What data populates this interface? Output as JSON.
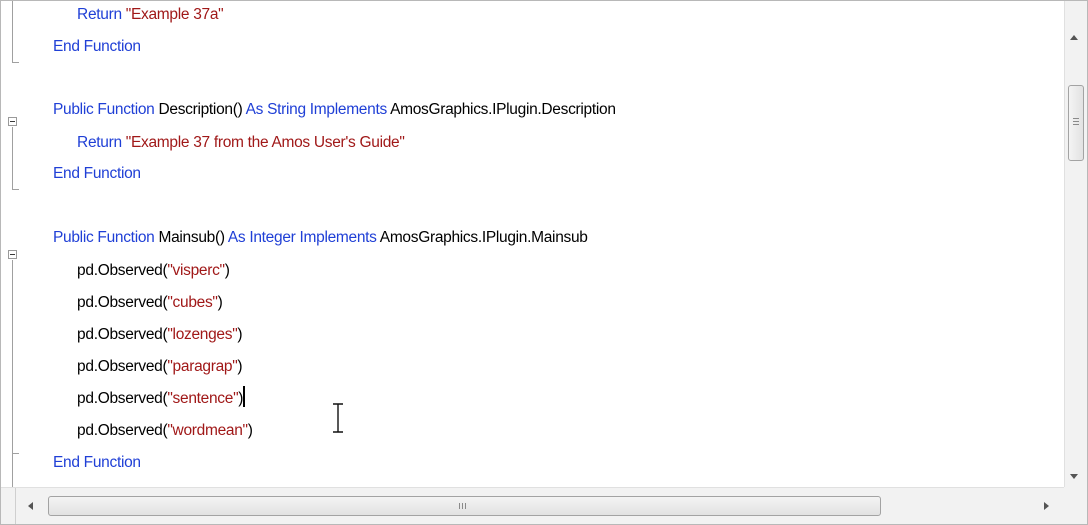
{
  "editor": {
    "lines": [
      {
        "indent": "   ",
        "tokens": [
          {
            "text": "Return ",
            "kind": "kw"
          },
          {
            "text": "\"Example 37a\"",
            "kind": "str"
          }
        ]
      },
      {
        "indent": "",
        "tokens": [
          {
            "text": "End Function",
            "kind": "kw"
          }
        ]
      },
      {
        "indent": "",
        "tokens": []
      },
      {
        "indent": "",
        "tokens": [
          {
            "text": "Public Function ",
            "kind": "kw"
          },
          {
            "text": "Description() ",
            "kind": "plain"
          },
          {
            "text": "As String Implements ",
            "kind": "kw"
          },
          {
            "text": "AmosGraphics.IPlugin.Description",
            "kind": "plain"
          }
        ]
      },
      {
        "indent": "   ",
        "tokens": [
          {
            "text": "Return ",
            "kind": "kw"
          },
          {
            "text": "\"Example 37 from the Amos User's Guide\"",
            "kind": "str"
          }
        ]
      },
      {
        "indent": "",
        "tokens": [
          {
            "text": "End Function",
            "kind": "kw"
          }
        ]
      },
      {
        "indent": "",
        "tokens": []
      },
      {
        "indent": "",
        "tokens": [
          {
            "text": "Public Function ",
            "kind": "kw"
          },
          {
            "text": "Mainsub() ",
            "kind": "plain"
          },
          {
            "text": "As Integer Implements ",
            "kind": "kw"
          },
          {
            "text": "AmosGraphics.IPlugin.Mainsub",
            "kind": "plain"
          }
        ]
      },
      {
        "indent": "   ",
        "tokens": [
          {
            "text": "pd.Observed(",
            "kind": "plain"
          },
          {
            "text": "\"visperc\"",
            "kind": "str"
          },
          {
            "text": ")",
            "kind": "plain"
          }
        ]
      },
      {
        "indent": "   ",
        "tokens": [
          {
            "text": "pd.Observed(",
            "kind": "plain"
          },
          {
            "text": "\"cubes\"",
            "kind": "str"
          },
          {
            "text": ")",
            "kind": "plain"
          }
        ]
      },
      {
        "indent": "   ",
        "tokens": [
          {
            "text": "pd.Observed(",
            "kind": "plain"
          },
          {
            "text": "\"lozenges\"",
            "kind": "str"
          },
          {
            "text": ")",
            "kind": "plain"
          }
        ]
      },
      {
        "indent": "   ",
        "tokens": [
          {
            "text": "pd.Observed(",
            "kind": "plain"
          },
          {
            "text": "\"paragrap\"",
            "kind": "str"
          },
          {
            "text": ")",
            "kind": "plain"
          }
        ]
      },
      {
        "indent": "   ",
        "tokens": [
          {
            "text": "pd.Observed(",
            "kind": "plain"
          },
          {
            "text": "\"sentence\"",
            "kind": "str"
          },
          {
            "text": ")",
            "kind": "plain"
          }
        ],
        "caret": true
      },
      {
        "indent": "   ",
        "tokens": [
          {
            "text": "pd.Observed(",
            "kind": "plain"
          },
          {
            "text": "\"wordmean\"",
            "kind": "str"
          },
          {
            "text": ")",
            "kind": "plain"
          }
        ]
      },
      {
        "indent": "",
        "tokens": [
          {
            "text": "End Function",
            "kind": "kw"
          }
        ]
      }
    ]
  },
  "scrollbars": {
    "vertical_grip_icon": "grip-lines-icon",
    "horizontal_grip_icon": "grip-lines-icon"
  },
  "colors": {
    "keyword": "#1f3fd6",
    "string": "#a01818",
    "plain": "#000000"
  }
}
